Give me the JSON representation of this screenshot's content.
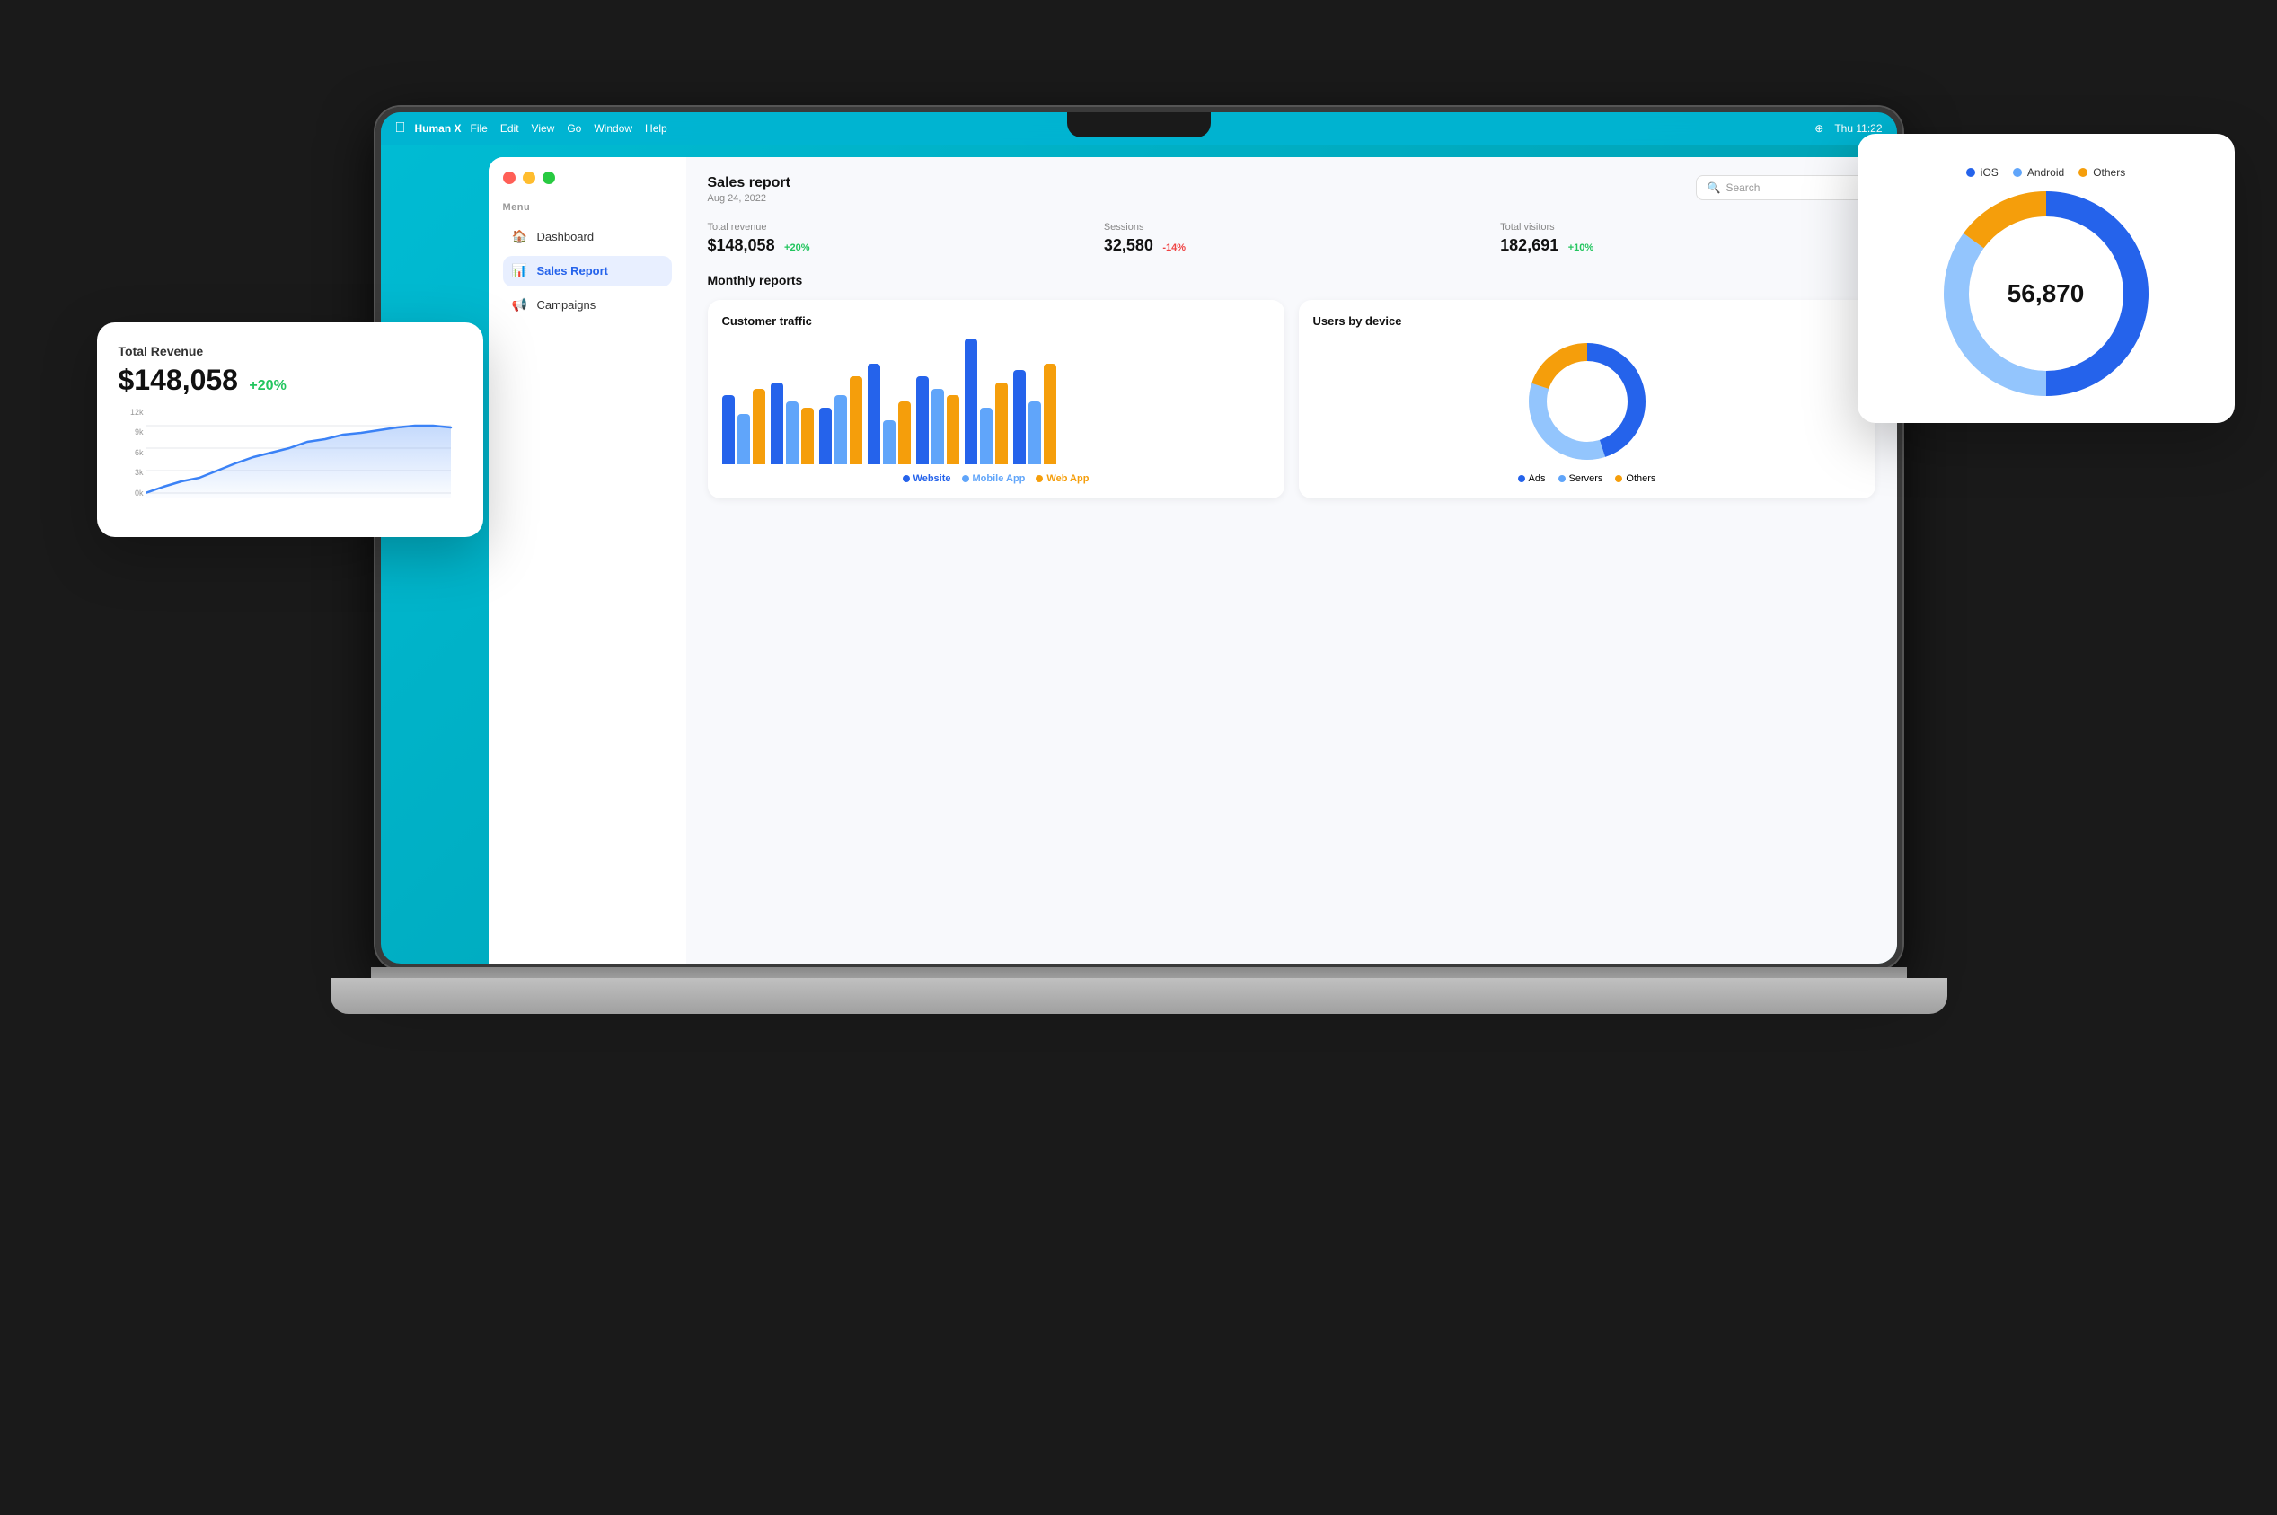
{
  "os": {
    "menubar": {
      "apple": "⌘",
      "app_name": "Human X",
      "menus": [
        "File",
        "Edit",
        "View",
        "Go",
        "Window",
        "Help"
      ],
      "time": "Thu 11:22"
    }
  },
  "sidebar": {
    "section_label": "Menu",
    "items": [
      {
        "id": "dashboard",
        "label": "Dashboard",
        "icon": "🏠",
        "active": false
      },
      {
        "id": "sales-report",
        "label": "Sales Report",
        "icon": "📊",
        "active": true
      },
      {
        "id": "campaigns",
        "label": "Campaigns",
        "icon": "📢",
        "active": false
      }
    ]
  },
  "header": {
    "title": "Sales report",
    "date": "Aug 24, 2022",
    "search_placeholder": "Search"
  },
  "stats": [
    {
      "label": "Total revenue",
      "value": "$148,058",
      "change": "+20%",
      "positive": true
    },
    {
      "label": "Sessions",
      "value": "32,580",
      "change": "-14%",
      "positive": false
    },
    {
      "label": "Total visitors",
      "value": "182,691",
      "change": "+10%",
      "positive": true
    }
  ],
  "monthly_reports": {
    "title": "Monthly reports"
  },
  "customer_traffic": {
    "title": "Customer traffic",
    "legend": [
      {
        "key": "website",
        "label": "Website",
        "color": "#2563eb"
      },
      {
        "key": "mobile",
        "label": "Mobile App",
        "color": "#60a5fa"
      },
      {
        "key": "webapp",
        "label": "Web App",
        "color": "#f59e0b"
      }
    ],
    "bars": [
      {
        "website": 55,
        "mobile": 40,
        "webapp": 60
      },
      {
        "website": 65,
        "mobile": 50,
        "webapp": 45
      },
      {
        "website": 45,
        "mobile": 55,
        "webapp": 70
      },
      {
        "website": 80,
        "mobile": 35,
        "webapp": 50
      },
      {
        "website": 70,
        "mobile": 60,
        "webapp": 55
      },
      {
        "website": 100,
        "mobile": 45,
        "webapp": 65
      },
      {
        "website": 75,
        "mobile": 50,
        "webapp": 80
      }
    ]
  },
  "users_by_device": {
    "title": "Users by device",
    "legend": [
      {
        "key": "ads",
        "label": "Ads",
        "color": "#2563eb"
      },
      {
        "key": "servers",
        "label": "Servers",
        "color": "#60a5fa"
      },
      {
        "key": "others",
        "label": "Others",
        "color": "#f59e0b"
      }
    ],
    "segments": [
      {
        "key": "ads",
        "value": 45,
        "color": "#2563eb"
      },
      {
        "key": "servers",
        "value": 35,
        "color": "#93c5fd"
      },
      {
        "key": "others",
        "value": 20,
        "color": "#f59e0b"
      }
    ]
  },
  "floating_revenue": {
    "title": "Total Revenue",
    "value": "$148,058",
    "change": "+20%",
    "y_labels": [
      "12k",
      "9k",
      "6k",
      "3k",
      "0k"
    ]
  },
  "floating_device": {
    "count": "56,870",
    "legend": [
      {
        "label": "iOS",
        "color": "#2563eb"
      },
      {
        "label": "Android",
        "color": "#60a5fa"
      },
      {
        "label": "Others",
        "color": "#f59e0b"
      }
    ],
    "segments": [
      {
        "label": "iOS",
        "value": 50,
        "color": "#2563eb"
      },
      {
        "label": "Android",
        "value": 35,
        "color": "#93c5fd"
      },
      {
        "label": "Others",
        "value": 15,
        "color": "#f59e0b"
      }
    ]
  }
}
